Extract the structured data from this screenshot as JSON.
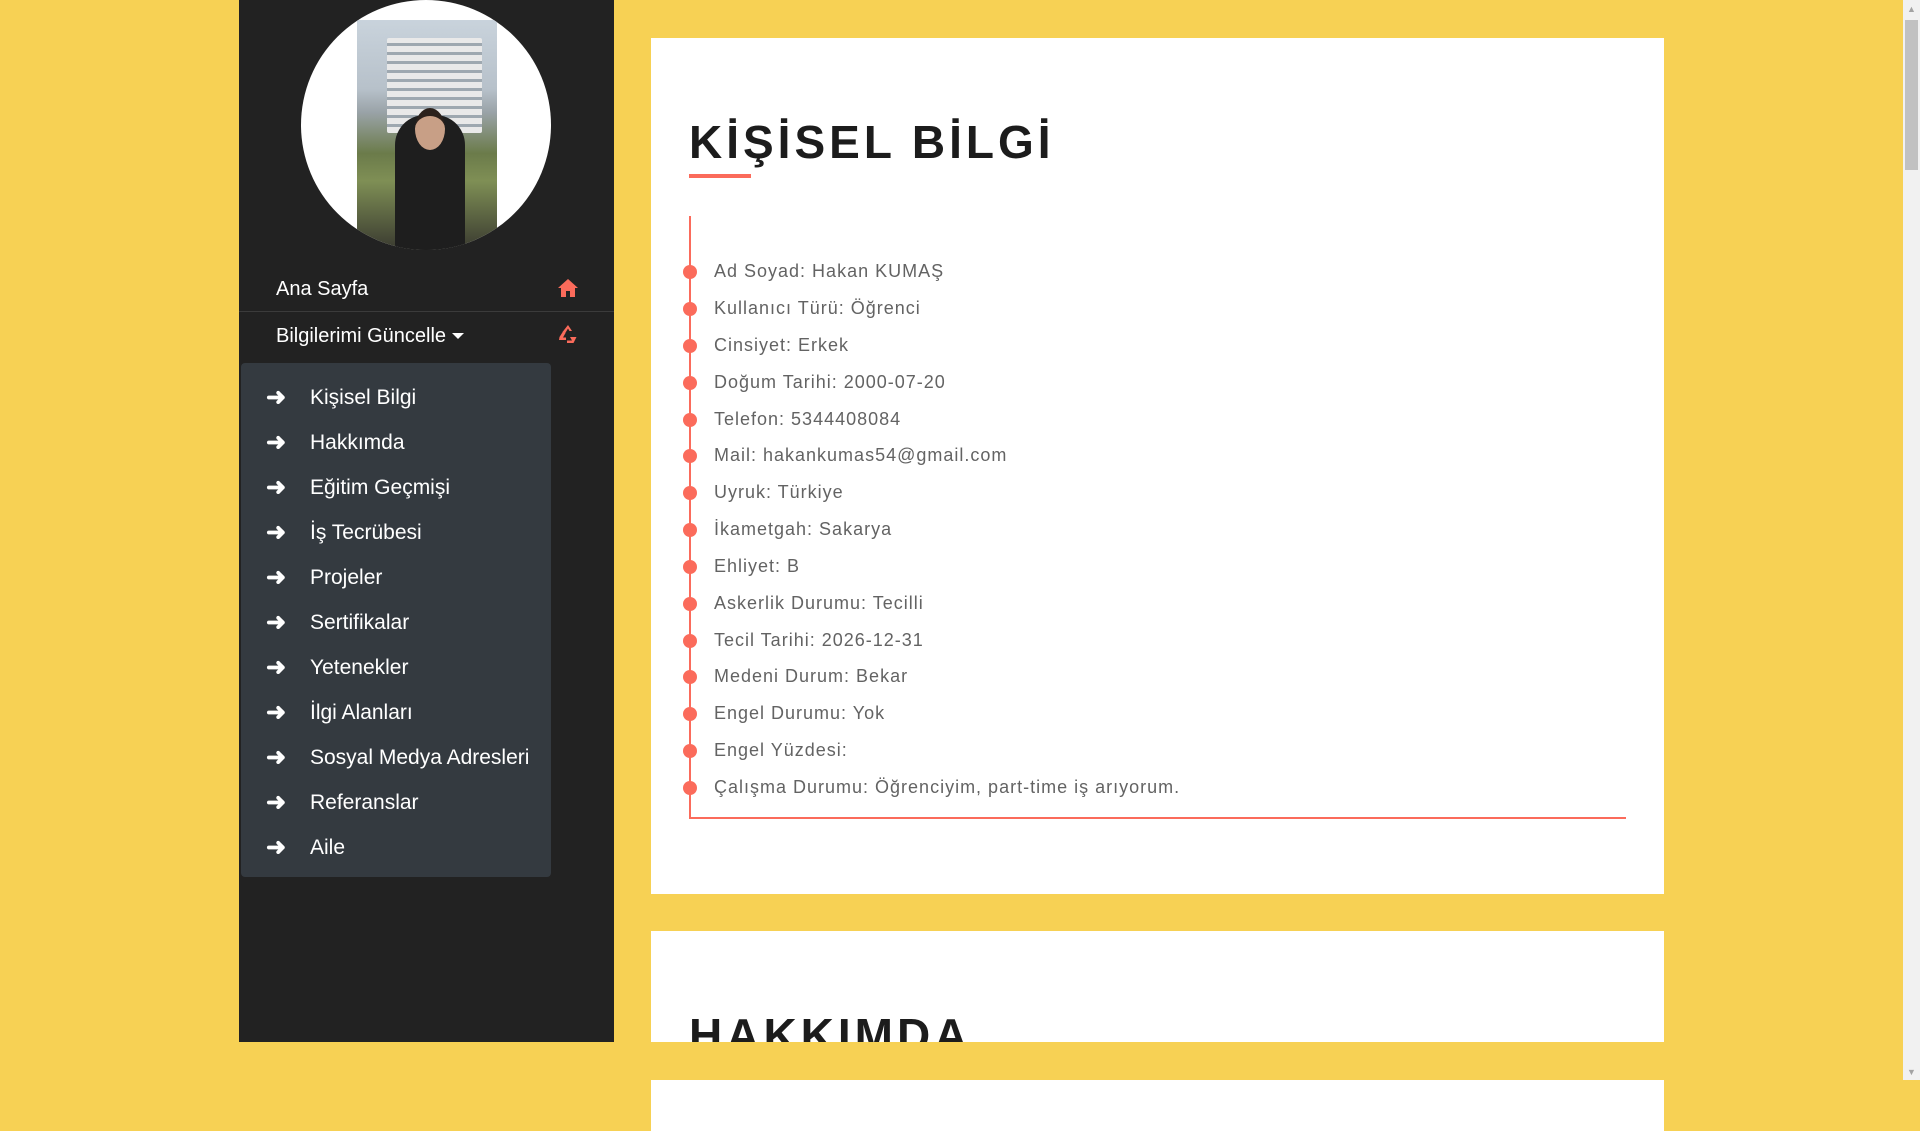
{
  "sidebar": {
    "profile_photo_alt": "profile photo",
    "nav": {
      "home_label": "Ana Sayfa",
      "home_icon": "home-icon",
      "update_label": "Bilgilerimi Güncelle",
      "update_icon": "recycle-icon"
    },
    "dropdown_items": [
      "Kişisel Bilgi",
      "Hakkımda",
      "Eğitim Geçmişi",
      "İş Tecrübesi",
      "Projeler",
      "Sertifikalar",
      "Yetenekler",
      "İlgi Alanları",
      "Sosyal Medya Adresleri",
      "Referanslar",
      "Aile"
    ]
  },
  "personal_info": {
    "title": "KİŞİSEL BİLGİ",
    "items": [
      "Ad Soyad: Hakan KUMAŞ",
      "Kullanıcı Türü: Öğrenci",
      "Cinsiyet: Erkek",
      "Doğum Tarihi: 2000-07-20",
      "Telefon: 5344408084",
      "Mail: hakankumas54@gmail.com",
      "Uyruk: Türkiye",
      "İkametgah: Sakarya",
      "Ehliyet: B",
      "Askerlik Durumu: Tecilli",
      "Tecil Tarihi: 2026-12-31",
      "Medeni Durum: Bekar",
      "Engel Durumu: Yok",
      "Engel Yüzdesi:",
      "Çalışma Durumu: Öğrenciyim, part-time iş arıyorum."
    ]
  },
  "about": {
    "title": "HAKKIMDA"
  },
  "colors": {
    "background": "#f7d154",
    "sidebar": "#222222",
    "dropdown": "#343a40",
    "accent": "#fb6b5b"
  }
}
